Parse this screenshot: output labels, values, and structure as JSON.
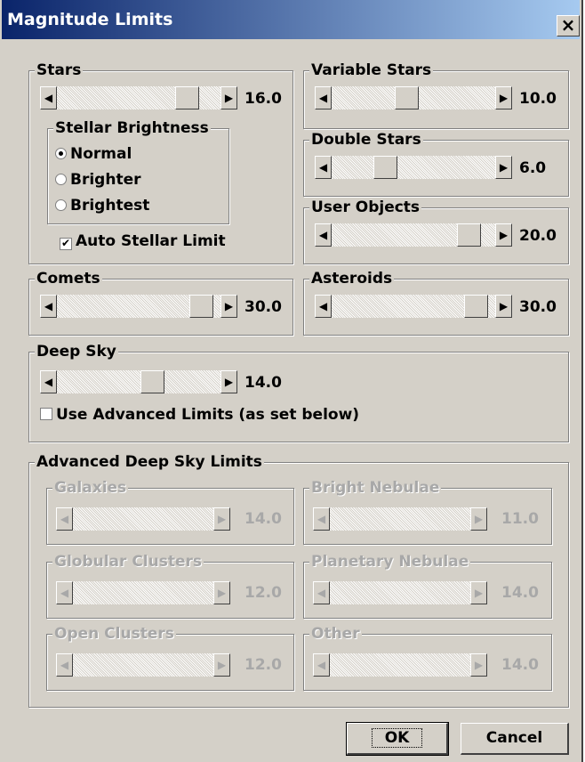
{
  "window": {
    "title": "Magnitude Limits",
    "close_glyph": "×"
  },
  "stars": {
    "label": "Stars",
    "value": "16.0",
    "slider_fraction": 0.85,
    "brightness": {
      "label": "Stellar Brightness",
      "options": [
        "Normal",
        "Brighter",
        "Brightest"
      ],
      "selected": "Normal"
    },
    "auto_limit": {
      "label": "Auto Stellar Limit",
      "checked": true
    }
  },
  "variable_stars": {
    "label": "Variable Stars",
    "value": "10.0",
    "slider_fraction": 0.45
  },
  "double_stars": {
    "label": "Double Stars",
    "value": "6.0",
    "slider_fraction": 0.3
  },
  "user_objects": {
    "label": "User Objects",
    "value": "20.0",
    "slider_fraction": 0.9
  },
  "comets": {
    "label": "Comets",
    "value": "30.0",
    "slider_fraction": 0.95
  },
  "asteroids": {
    "label": "Asteroids",
    "value": "30.0",
    "slider_fraction": 0.95
  },
  "deep_sky": {
    "label": "Deep Sky",
    "value": "14.0",
    "slider_fraction": 0.6,
    "advanced_checkbox": {
      "label": "Use Advanced Limits (as set below)",
      "checked": false
    }
  },
  "advanced": {
    "label": "Advanced Deep Sky Limits",
    "galaxies": {
      "label": "Galaxies",
      "value": "14.0"
    },
    "bright_nebulae": {
      "label": "Bright Nebulae",
      "value": "11.0"
    },
    "globular_clusters": {
      "label": "Globular Clusters",
      "value": "12.0"
    },
    "planetary_nebulae": {
      "label": "Planetary Nebulae",
      "value": "14.0"
    },
    "open_clusters": {
      "label": "Open Clusters",
      "value": "12.0"
    },
    "other": {
      "label": "Other",
      "value": "14.0"
    }
  },
  "buttons": {
    "ok": "OK",
    "cancel": "Cancel"
  },
  "icons": {
    "left_arrow": "◀",
    "right_arrow": "▶",
    "check": "✔"
  }
}
